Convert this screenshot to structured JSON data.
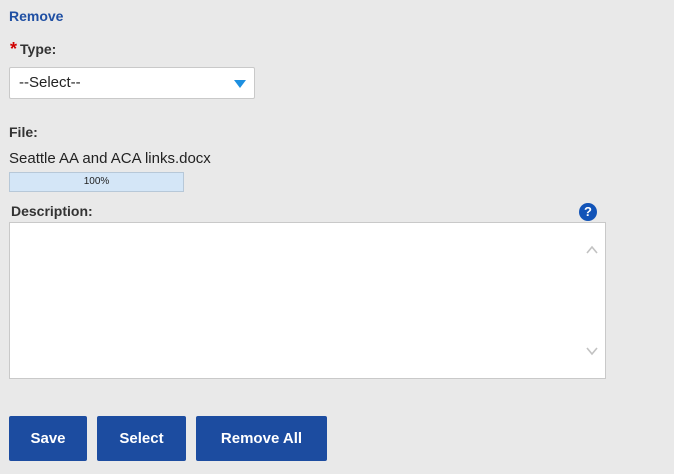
{
  "remove_link": "Remove",
  "type_field": {
    "required_mark": "*",
    "label": "Type:",
    "selected": "--Select--"
  },
  "file": {
    "label": "File:",
    "name": "Seattle AA and ACA links.docx",
    "progress_percent": 100,
    "progress_text": "100%"
  },
  "description": {
    "label": "Description:",
    "help_glyph": "?",
    "value": ""
  },
  "buttons": {
    "save": "Save",
    "select": "Select",
    "remove_all": "Remove All"
  },
  "colors": {
    "accent": "#1c4ca0",
    "link": "#1f4fa3",
    "required": "#d00000",
    "dropdown_arrow": "#1d8fe0",
    "progress_fill": "#d4e6f7",
    "background": "#e9e9e9"
  },
  "icons": {
    "dropdown": "chevron-down-icon",
    "help": "help-icon",
    "scroll_up": "scroll-up-icon",
    "scroll_down": "scroll-down-icon"
  }
}
